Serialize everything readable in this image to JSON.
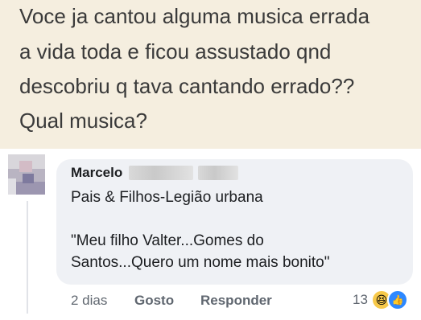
{
  "post": {
    "lines": [
      "Voce ja cantou alguma musica errada",
      "a vida toda e ficou assustado qnd",
      "descobriu q tava cantando errado??",
      "Qual musica?"
    ]
  },
  "comment": {
    "author": "Marcelo",
    "text_line1": "Pais & Filhos-Legião urbana",
    "text_line2": "\"Meu filho Valter...Gomes do",
    "text_line3": "Santos...Quero um nome mais bonito\"",
    "time": "2 dias",
    "like_label": "Gosto",
    "reply_label": "Responder",
    "reaction_count": "13",
    "reaction_icons": [
      "laughing-emoji-icon",
      "like-thumb-icon"
    ]
  },
  "colors": {
    "post_background": "#f5eedf",
    "bubble_background": "#eff1f5",
    "like_blue": "#2d88ff"
  }
}
